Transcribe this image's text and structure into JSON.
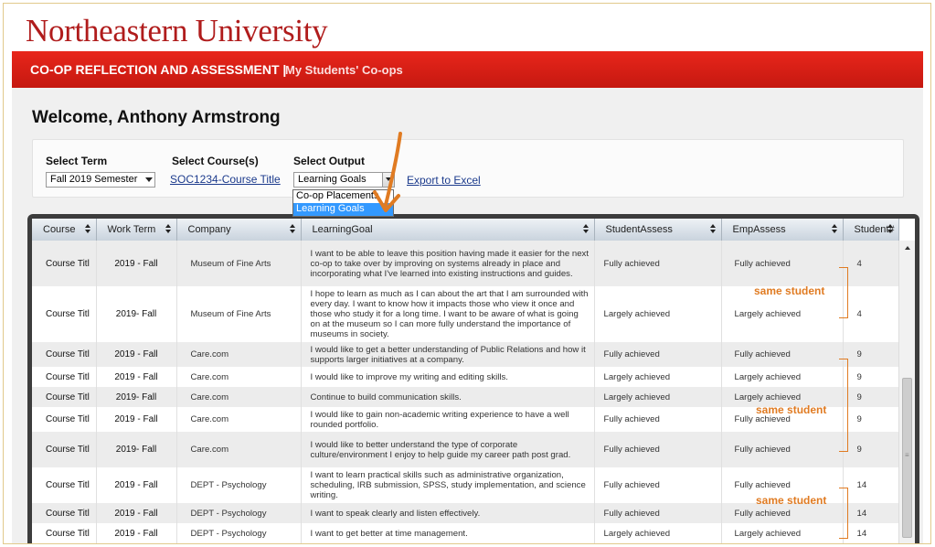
{
  "logo": "Northeastern University",
  "header": {
    "title": "CO-OP REFLECTION AND ASSESSMENT",
    "separator": "|",
    "subtitle": "My Students' Co-ops"
  },
  "welcome": "Welcome, Anthony Armstrong",
  "filters": {
    "term_label": "Select Term",
    "term_value": "Fall 2019 Semester",
    "course_label": "Select Course(s)",
    "course_link": "SOC1234-Course Title",
    "output_label": "Select Output",
    "output_value": "Learning Goals",
    "output_options": [
      "Co-op Placements",
      "Learning Goals"
    ],
    "export_link": "Export to Excel"
  },
  "table": {
    "columns": [
      "Course",
      "Work Term",
      "Company",
      "LearningGoal",
      "StudentAssess",
      "EmpAssess",
      "Student#"
    ],
    "rows": [
      [
        "Course Titl",
        "2019 - Fall",
        "Museum of Fine Arts",
        "I want to be able to leave this position having made it easier for the next co-op to take over by improving on systems already in place and incorporating what I've learned into existing instructions and guides.",
        "Fully achieved",
        "Fully achieved",
        "4"
      ],
      [
        "Course Titl",
        "2019- Fall",
        "Museum of Fine Arts",
        "I hope to learn as much as I can about the art that I am surrounded with every day.  I want to know how it impacts those who view it once and those who study it for a long time.  I want to be aware of what is going on at the museum so I can more fully understand the importance of museums in society.",
        "Largely achieved",
        "Largely achieved",
        "4"
      ],
      [
        "Course Titl",
        "2019 - Fall",
        "Care.com",
        "I would like to get a better understanding of Public Relations and how it supports larger initiatives at a company.",
        "Fully achieved",
        "Fully achieved",
        "9"
      ],
      [
        "Course Titl",
        "2019 - Fall",
        "Care.com",
        "I would like to improve my writing and editing skills.",
        "Largely achieved",
        "Largely achieved",
        "9"
      ],
      [
        "Course Titl",
        "2019- Fall",
        "Care.com",
        "Continue to build communication skills.",
        "Largely achieved",
        "Largely achieved",
        "9"
      ],
      [
        "Course Titl",
        "2019 - Fall",
        "Care.com",
        "I would like to gain non-academic writing experience to have a well rounded portfolio.",
        "Fully achieved",
        "Fully achieved",
        "9"
      ],
      [
        "Course Titl",
        "2019- Fall",
        "Care.com",
        "I would like to better understand the type of corporate culture/environment I enjoy to help guide my career path post grad.",
        "Fully achieved",
        "Fully achieved",
        "9"
      ],
      [
        "Course Titl",
        "2019 - Fall",
        "DEPT - Psychology",
        "I want to learn practical skills such as administrative organization, scheduling, IRB submission, SPSS, study implementation, and science writing.",
        "Fully achieved",
        "Fully achieved",
        "14"
      ],
      [
        "Course Titl",
        "2019 - Fall",
        "DEPT - Psychology",
        "I want to speak clearly and listen effectively.",
        "Fully achieved",
        "Fully achieved",
        "14"
      ],
      [
        "Course Titl",
        "2019 - Fall",
        "DEPT - Psychology",
        "I want to get better at time management.",
        "Largely achieved",
        "Largely achieved",
        "14"
      ]
    ]
  },
  "annotations": {
    "same_student_1": "same student",
    "same_student_2": "same student",
    "same_student_3": "same student"
  },
  "colors": {
    "brand_red": "#c51810",
    "annotation_orange": "#e07b22",
    "link_blue": "#1b3a8c"
  }
}
